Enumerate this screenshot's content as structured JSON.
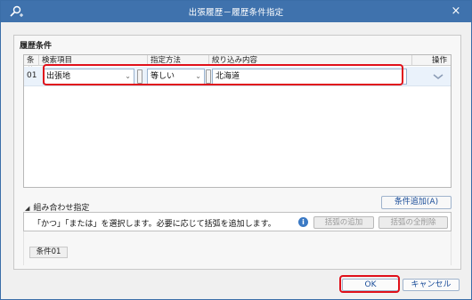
{
  "window": {
    "title": "出張履歴－履歴条件指定",
    "close_glyph": "×"
  },
  "section": {
    "title": "履歴条件"
  },
  "table": {
    "headers": {
      "cond": "条件",
      "item": "検索項目",
      "method": "指定方法",
      "content": "絞り込み内容",
      "op": "操作"
    },
    "row": {
      "num": "01",
      "item": "出張地",
      "method": "等しい",
      "content": "北海道"
    }
  },
  "combination": {
    "label": "組み合わせ指定",
    "add_button": "条件追加(A)",
    "description": "「かつ」「または」を選択します。必要に応じて括弧を追加します。",
    "add_paren_button": "括弧の追加",
    "delete_paren_button": "括弧の全削除",
    "chip": "条件01"
  },
  "footer": {
    "ok": "OK",
    "cancel": "キャンセル"
  },
  "colors": {
    "titlebar": "#3f72ad",
    "highlight": "#e0101a",
    "link_text": "#1a4d99"
  }
}
